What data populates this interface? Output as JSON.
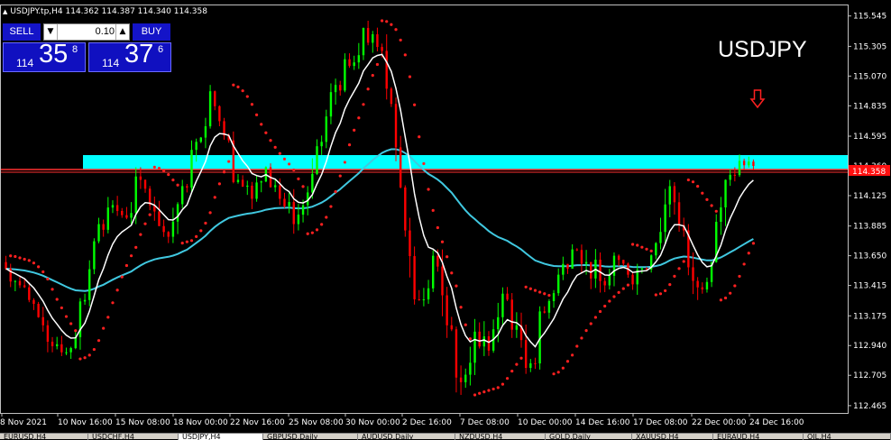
{
  "header": {
    "info": "USDJPY.tp,H4  114.362 114.387 114.340 114.358"
  },
  "chart_label": "USDJPY",
  "trade_panel": {
    "sell_label": "SELL",
    "buy_label": "BUY",
    "lot_value": "0.10",
    "sell_price": {
      "small": "114",
      "big": "35",
      "sup": "8"
    },
    "buy_price": {
      "small": "114",
      "big": "37",
      "sup": "6"
    }
  },
  "price_axis": {
    "labels": [
      "115.545",
      "115.305",
      "115.070",
      "114.835",
      "114.595",
      "114.360",
      "114.125",
      "113.885",
      "113.650",
      "113.415",
      "113.175",
      "112.940",
      "112.705",
      "112.465"
    ],
    "current_price": "114.358"
  },
  "time_axis": {
    "labels": [
      "8 Nov 2021",
      "10 Nov 16:00",
      "15 Nov 08:00",
      "18 Nov 00:00",
      "22 Nov 16:00",
      "25 Nov 08:00",
      "30 Nov 00:00",
      "2 Dec 16:00",
      "7 Dec 08:00",
      "10 Dec 00:00",
      "14 Dec 16:00",
      "17 Dec 08:00",
      "22 Dec 00:00",
      "24 Dec 16:00"
    ]
  },
  "tabs": [
    "EURUSD,H4",
    "USDCHF,H4",
    "USDJPY,H4",
    "GBPUSD,Daily",
    "AUDUSD,Daily",
    "NZDUSD,H4",
    "GOLD,Daily",
    "XAUUSD,H4",
    "EURAUD,H4",
    "OIL,H4"
  ],
  "colors": {
    "bull": "#00ff00",
    "bear": "#ff0000",
    "zone": "#00ffff",
    "ma_fast": "#ffffff",
    "ma_slow": "#40c8e0",
    "sar": "#ff2020",
    "price_line": "#ff3030"
  },
  "chart_data": {
    "type": "candlestick",
    "symbol": "USDJPY",
    "timeframe": "H4",
    "ylim": [
      112.44,
      115.62
    ],
    "zone": [
      114.4,
      114.56
    ],
    "resistance_level": 114.36,
    "signal": "sell",
    "ohlc": [
      [
        113.6,
        113.7,
        113.35,
        113.45
      ],
      [
        113.45,
        113.5,
        113.2,
        113.3
      ],
      [
        113.3,
        113.4,
        113.05,
        113.1
      ],
      [
        113.1,
        113.2,
        112.85,
        112.95
      ],
      [
        112.95,
        113.05,
        112.78,
        112.92
      ],
      [
        112.92,
        113.35,
        112.9,
        113.3
      ],
      [
        113.3,
        113.95,
        113.25,
        113.9
      ],
      [
        113.9,
        114.15,
        113.8,
        114.05
      ],
      [
        114.05,
        114.2,
        113.85,
        113.95
      ],
      [
        113.95,
        114.35,
        113.9,
        114.25
      ],
      [
        114.25,
        114.3,
        113.9,
        114.0
      ],
      [
        114.0,
        114.1,
        113.75,
        113.8
      ],
      [
        113.8,
        114.25,
        113.75,
        114.2
      ],
      [
        114.2,
        114.6,
        114.15,
        114.55
      ],
      [
        114.55,
        115.0,
        114.5,
        114.95
      ],
      [
        114.95,
        115.0,
        114.55,
        114.6
      ],
      [
        114.6,
        114.65,
        114.2,
        114.25
      ],
      [
        114.25,
        114.35,
        114.0,
        114.1
      ],
      [
        114.1,
        114.4,
        114.05,
        114.35
      ],
      [
        114.35,
        114.45,
        114.05,
        114.1
      ],
      [
        114.1,
        114.2,
        113.75,
        113.9
      ],
      [
        113.9,
        114.2,
        113.85,
        114.15
      ],
      [
        114.15,
        114.6,
        114.1,
        114.55
      ],
      [
        114.55,
        115.05,
        114.5,
        115.0
      ],
      [
        115.0,
        115.25,
        114.9,
        115.15
      ],
      [
        115.15,
        115.5,
        115.1,
        115.45
      ],
      [
        115.45,
        115.55,
        115.2,
        115.3
      ],
      [
        115.3,
        115.4,
        114.8,
        114.85
      ],
      [
        114.85,
        114.9,
        113.8,
        113.85
      ],
      [
        113.85,
        113.95,
        113.2,
        113.3
      ],
      [
        113.3,
        113.75,
        113.25,
        113.65
      ],
      [
        113.65,
        113.7,
        113.0,
        113.1
      ],
      [
        113.1,
        113.2,
        112.55,
        112.65
      ],
      [
        112.65,
        113.15,
        112.6,
        113.05
      ],
      [
        113.05,
        113.3,
        112.8,
        112.9
      ],
      [
        112.9,
        113.4,
        112.85,
        113.35
      ],
      [
        113.35,
        113.55,
        113.0,
        113.1
      ],
      [
        113.1,
        113.2,
        112.65,
        112.8
      ],
      [
        112.8,
        113.25,
        112.75,
        113.2
      ],
      [
        113.2,
        113.55,
        113.15,
        113.5
      ],
      [
        113.5,
        113.75,
        113.4,
        113.7
      ],
      [
        113.7,
        113.9,
        113.5,
        113.6
      ],
      [
        113.6,
        113.75,
        113.35,
        113.45
      ],
      [
        113.45,
        113.7,
        113.35,
        113.65
      ],
      [
        113.65,
        113.7,
        113.4,
        113.5
      ],
      [
        113.5,
        113.65,
        113.3,
        113.55
      ],
      [
        113.55,
        113.8,
        113.5,
        113.75
      ],
      [
        113.75,
        114.25,
        113.7,
        114.2
      ],
      [
        114.2,
        114.3,
        113.8,
        113.85
      ],
      [
        113.85,
        113.9,
        113.3,
        113.4
      ],
      [
        113.4,
        113.7,
        113.35,
        113.6
      ],
      [
        113.6,
        114.3,
        113.55,
        114.25
      ],
      [
        114.25,
        114.45,
        114.2,
        114.4
      ],
      [
        114.4,
        114.48,
        114.3,
        114.36
      ]
    ]
  }
}
